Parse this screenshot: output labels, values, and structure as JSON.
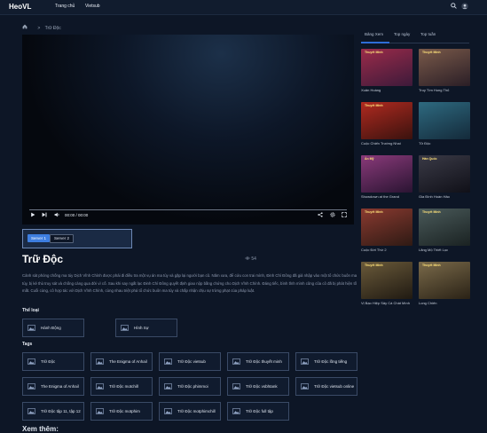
{
  "header": {
    "logo": "HeoVL",
    "nav": [
      "Trang chủ",
      "Vietsub"
    ],
    "search_icon": "search-icon",
    "user_icon": "user-icon"
  },
  "breadcrumb": {
    "home_icon": "home-icon",
    "separator": ">",
    "current": "Trữ Độc"
  },
  "player": {
    "time": "00:00 / 00:00",
    "controls": [
      "play-icon",
      "skip-icon",
      "volume-icon",
      "share-icon",
      "settings-icon",
      "fullscreen-icon"
    ]
  },
  "servers": [
    {
      "label": "Server 1",
      "active": true
    },
    {
      "label": "Server 2",
      "active": false
    }
  ],
  "movie": {
    "title": "Trữ Độc",
    "views": "54",
    "description": "Cảnh sát phòng chống ma túy Dịch Vĩnh Chính được phái đi điều tra một vụ án ma túy và gặp lại người bạn cũ. Năm xưa, để cứu con trai mình, Đinh Chí Đông đã giả nhập vào một tổ chức buôn ma túy, bị kẻ thù truy sát và chống càng qua đời vì cố. Sau khi say ngất lạc Đinh Chí Đông quyết định giao nộp bằng chứng cho Dịch Vĩnh Chính. Đáng tiếc, bình tĩnh mình cũng cũa cô đã bị phát hiện tố mất. Cuối cùng, cô hợp tác với Dịch Vĩnh Chính, cùng nhau triệt phá tổ chức buôn ma túy và chấp nhận chịu sự trừng phạt của pháp luật."
  },
  "genre_heading": "Thể loại",
  "genres": [
    "Hành Động",
    "Hình Sự"
  ],
  "tags_heading": "Tags",
  "tags": [
    "Trữ Độc",
    "The Enigma of Anhail",
    "Trữ Độc vietsub",
    "Trữ Độc thuyết minh",
    "Trữ Độc lồng tiếng",
    "The Enigma of Anhail",
    "Trữ Độc motchill",
    "Trữ Độc phimmoi",
    "Trữ Độc vsbhtank",
    "Trữ Độc vietsub online",
    "Trữ Độc tập 11, tập 12",
    "Trữ Độc motphim",
    "Trữ Độc motphimchill",
    "Trữ Độc full tập"
  ],
  "more_heading": "Xem thêm:",
  "sidebar": {
    "tabs": [
      "Bảng Xem",
      "Top ngày",
      "Top tuần"
    ],
    "items": [
      {
        "title": "Xuân Hoàng",
        "tag": "Thuyết Minh",
        "c1": "#9b2b4a",
        "c2": "#3d1a3a"
      },
      {
        "title": "Truy Tìm Hung Thủ",
        "tag": "Thuyết Minh",
        "c1": "#7a5a4a",
        "c2": "#2a1e26"
      },
      {
        "title": "Cuộc Chiến Trường Nhai",
        "tag": "Thuyết Minh",
        "c1": "#b02a20",
        "c2": "#3a120e"
      },
      {
        "title": "Tử Độc",
        "tag": "",
        "c1": "#2e6a80",
        "c2": "#142a3a"
      },
      {
        "title": "Showdown at the Grand",
        "tag": "Ẩn Mỹ",
        "c1": "#8a3a7a",
        "c2": "#2a1432"
      },
      {
        "title": "Gia Đình Hoàn Hảo",
        "tag": "Hàn Quốc",
        "c1": "#3a3a46",
        "c2": "#101018"
      },
      {
        "title": "Cuộc Đời Thứ 2",
        "tag": "Thuyết Minh",
        "c1": "#8a3a30",
        "c2": "#2e1a14"
      },
      {
        "title": "Lãng Mộ Thiết Lục",
        "tag": "Thuyết Minh",
        "c1": "#4a5a5a",
        "c2": "#1a2222"
      },
      {
        "title": "Vị Bạo Hiệp Sây Cá Chát Mình",
        "tag": "Thuyết Minh",
        "c1": "#6a5a3a",
        "c2": "#201a12"
      },
      {
        "title": "Long Chiến",
        "tag": "Thuyết Minh",
        "c1": "#7a6a4a",
        "c2": "#2a2216"
      }
    ]
  },
  "colors": {
    "accent": "#3d7ee0",
    "background": "#0d1626"
  }
}
